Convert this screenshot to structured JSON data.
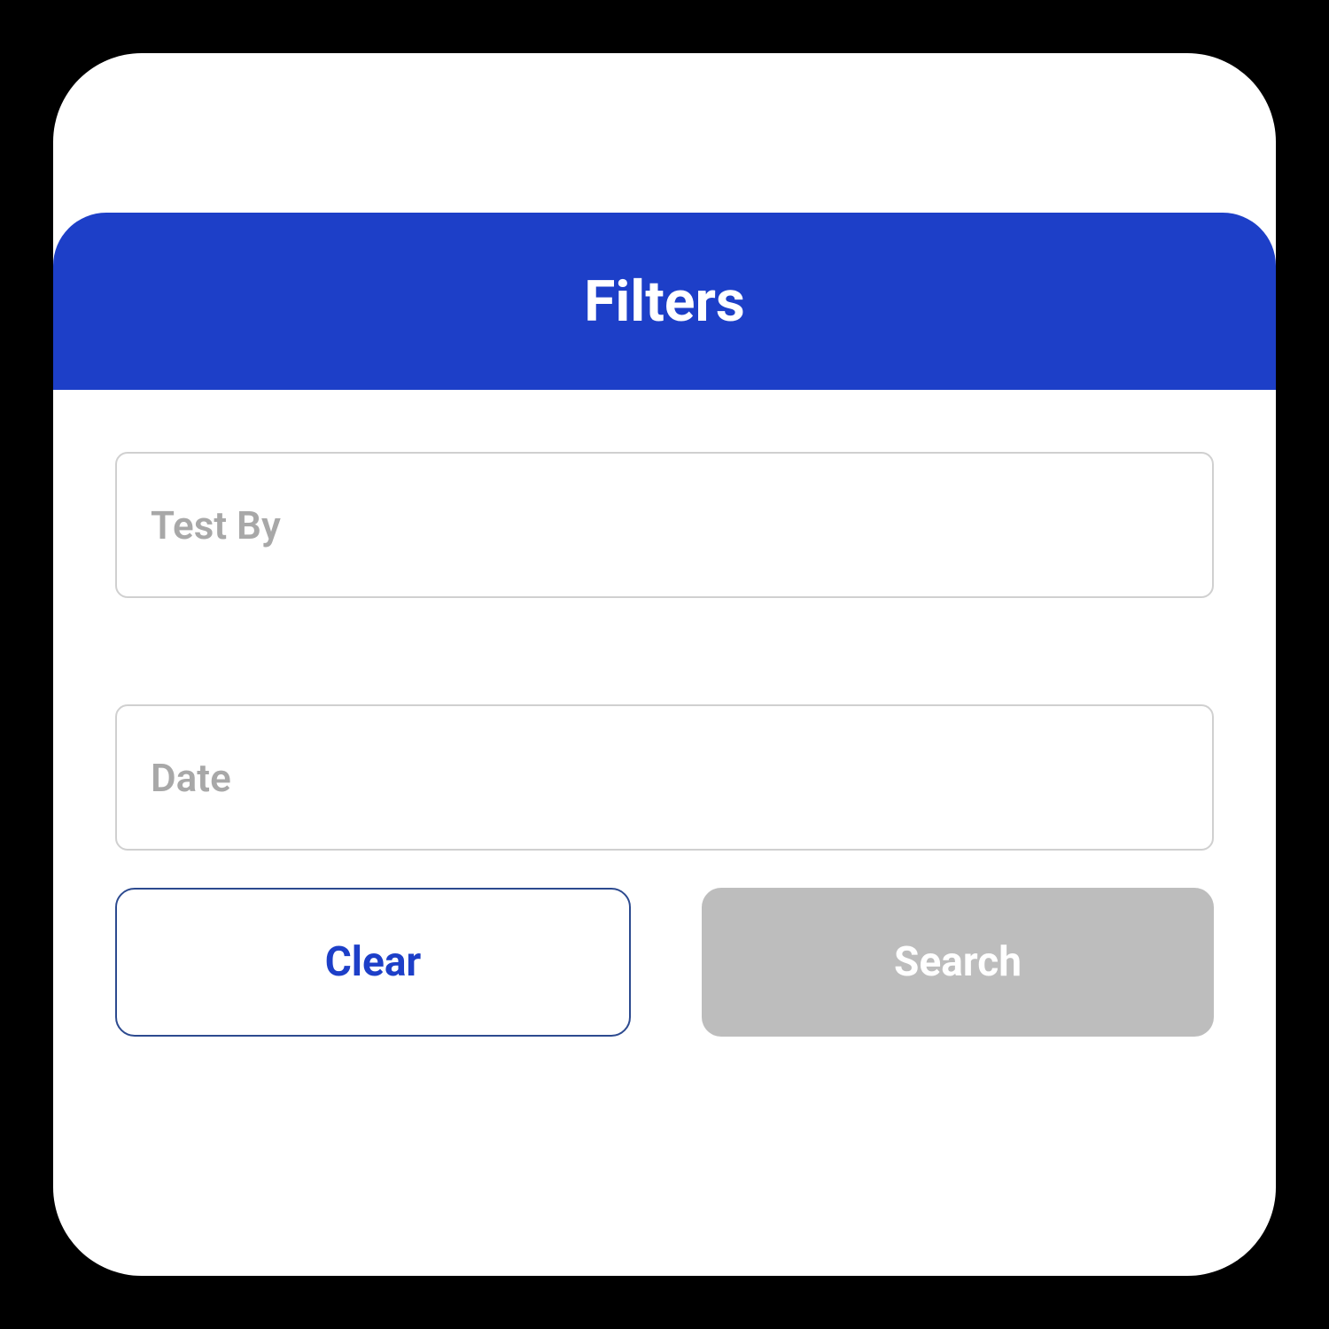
{
  "header": {
    "title": "Filters"
  },
  "form": {
    "testBy": {
      "placeholder": "Test By",
      "value": ""
    },
    "date": {
      "placeholder": "Date",
      "value": ""
    }
  },
  "buttons": {
    "clear": "Clear",
    "search": "Search"
  }
}
